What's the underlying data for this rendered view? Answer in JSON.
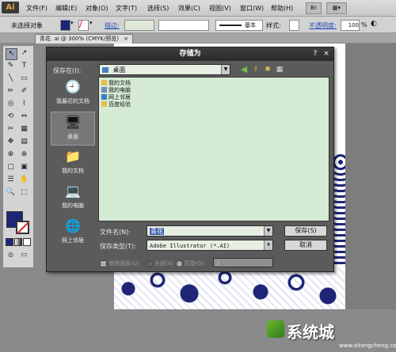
{
  "app": {
    "logo": "Ai"
  },
  "menu": {
    "items": [
      "文件(F)",
      "编辑(E)",
      "对象(O)",
      "文字(T)",
      "选择(S)",
      "效果(C)",
      "视图(V)",
      "窗口(W)",
      "帮助(H)"
    ],
    "bridge_label": "Br",
    "view_label": "▦▾"
  },
  "control": {
    "selection": "未选择对象",
    "stroke_label": "描边:",
    "line_style": "基本",
    "style_label": "样式:",
    "opacity_label": "不透明度:",
    "opacity": "100",
    "opacity_unit": "%"
  },
  "tab": {
    "title": "青花. ai @ 300% (CMYK/预览)",
    "close": "×"
  },
  "tools": [
    "↖",
    "↗",
    "✎",
    "T",
    "╲",
    "▭",
    "✏",
    "✐",
    "◎",
    "⌇",
    "⟲",
    "⇔",
    "✂",
    "▦",
    "✥",
    "▤",
    "⊕",
    "⊗",
    "▢",
    "▣",
    "☰",
    "✋",
    "🔍",
    "⬚"
  ],
  "colors": {
    "fill": "#1e2577",
    "artwork": "#1e2577",
    "dialog_bg": "#5b5b5b",
    "list_bg": "#d5ebd4"
  },
  "dialog": {
    "title": "存储为",
    "help_button": "?",
    "close_button": "×",
    "save_in_label": "保存在(I):",
    "save_in_value": "桌面",
    "places": [
      {
        "icon": "recent-icon",
        "label": "我最近的文档",
        "glyph": "🕘"
      },
      {
        "icon": "desktop-icon",
        "label": "桌面",
        "glyph": "🖥"
      },
      {
        "icon": "documents-icon",
        "label": "我的文档",
        "glyph": "📁"
      },
      {
        "icon": "computer-icon",
        "label": "我的电脑",
        "glyph": "💻"
      },
      {
        "icon": "network-icon",
        "label": "网上邻居",
        "glyph": "🌐"
      }
    ],
    "files": [
      {
        "name": "我的文档",
        "color": "#e5c04a"
      },
      {
        "name": "我的电脑",
        "color": "#6f8fb8"
      },
      {
        "name": "网上邻居",
        "color": "#3e7ec9"
      },
      {
        "name": "百度经验",
        "color": "#e5c04a"
      }
    ],
    "filename_label": "文件名(N):",
    "filename_value": "青花",
    "filetype_label": "保存类型(T):",
    "filetype_value": "Adobe Illustrator (*.AI)",
    "save_button": "保存(S)",
    "cancel_button": "取消",
    "use_artboards_label": "使用画板(U)",
    "all_label": "全部(A)",
    "range_label": "范围(G):",
    "range_value": "1"
  },
  "watermark": {
    "text": "系统城",
    "url": "www.xitongcheng.com"
  }
}
